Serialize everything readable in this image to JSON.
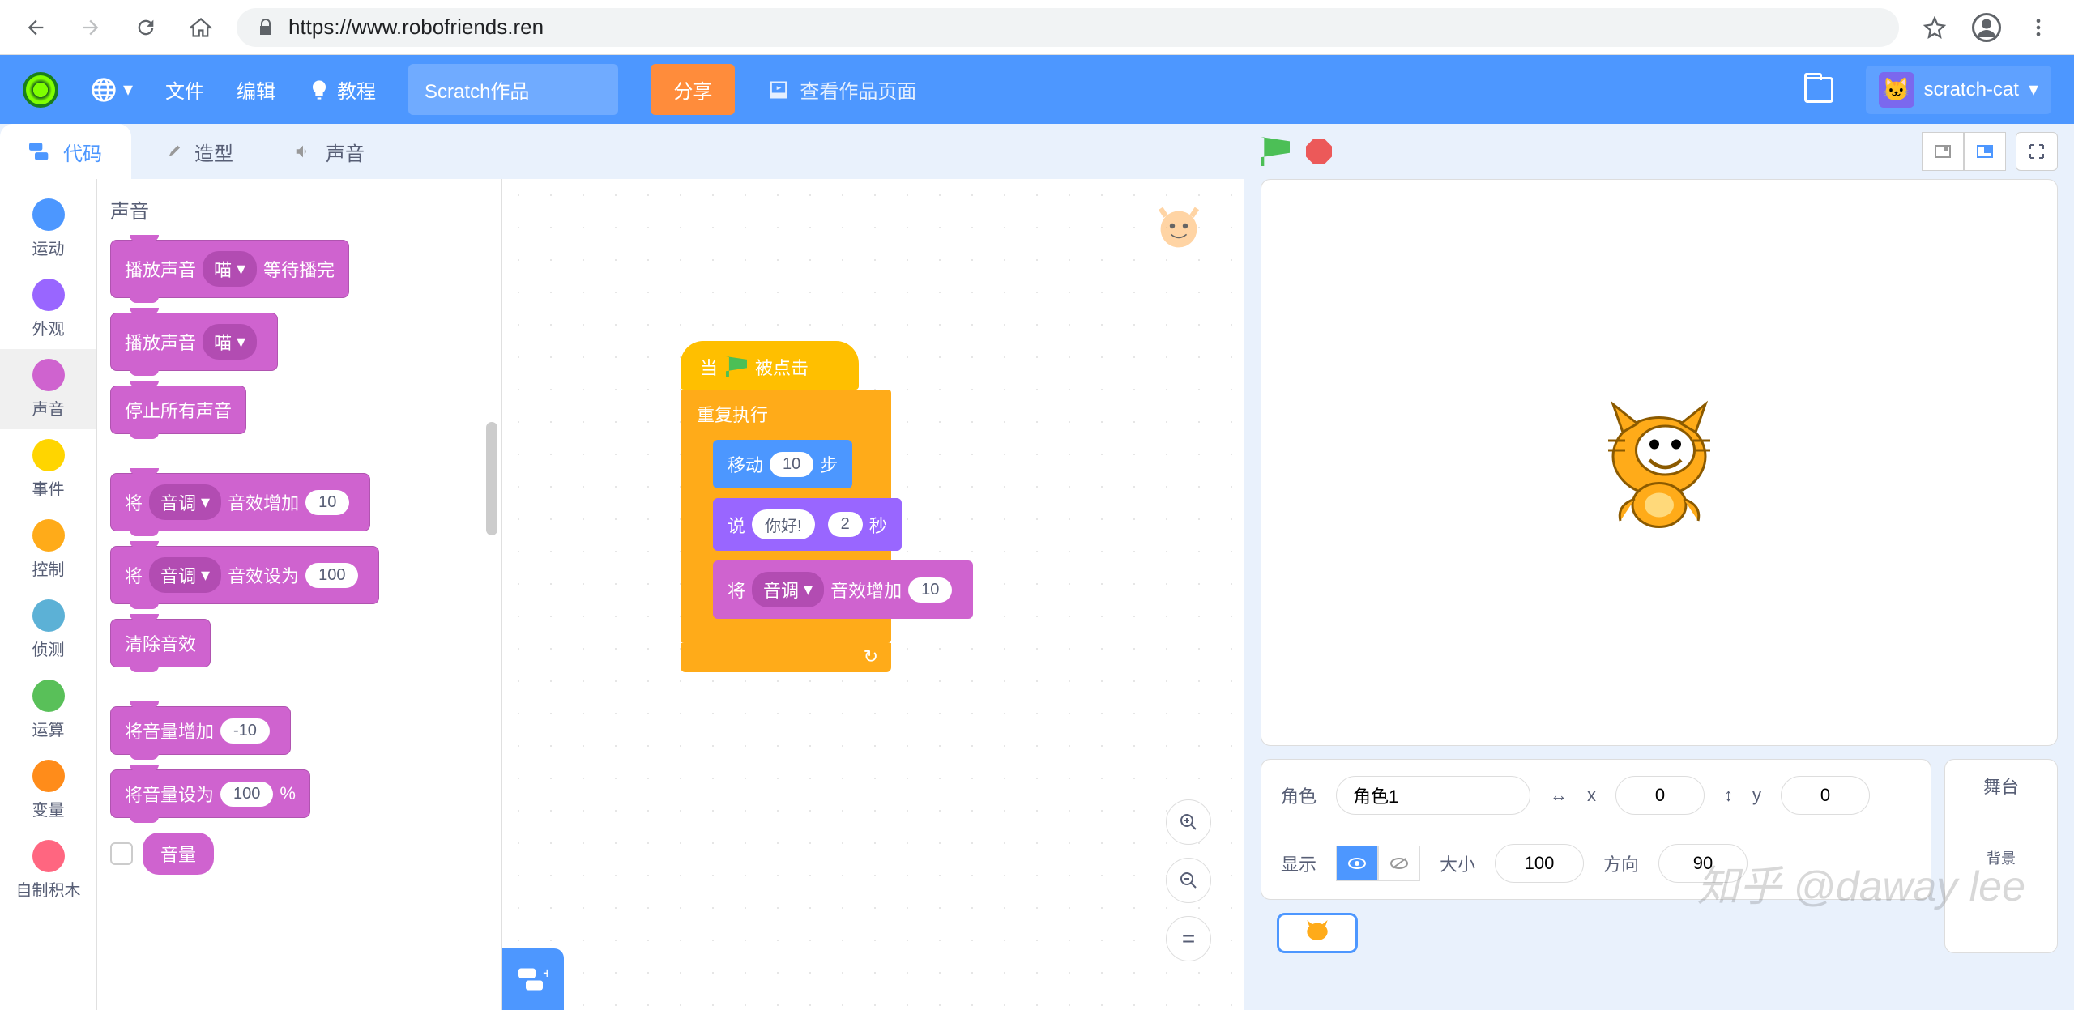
{
  "browser": {
    "url": "https://www.robofriends.ren"
  },
  "menu": {
    "file": "文件",
    "edit": "编辑",
    "tutorials": "教程",
    "project_title": "Scratch作品",
    "share": "分享",
    "view_page": "查看作品页面",
    "username": "scratch-cat"
  },
  "tabs": {
    "code": "代码",
    "costumes": "造型",
    "sounds": "声音"
  },
  "categories": [
    {
      "label": "运动",
      "color": "#4c97ff"
    },
    {
      "label": "外观",
      "color": "#9966ff"
    },
    {
      "label": "声音",
      "color": "#cf63cf"
    },
    {
      "label": "事件",
      "color": "#ffd500"
    },
    {
      "label": "控制",
      "color": "#ffab19"
    },
    {
      "label": "侦测",
      "color": "#5cb1d6"
    },
    {
      "label": "运算",
      "color": "#59c059"
    },
    {
      "label": "变量",
      "color": "#ff8c1a"
    },
    {
      "label": "自制积木",
      "color": "#ff6680"
    }
  ],
  "palette": {
    "title": "声音",
    "meow": "喵",
    "play_until_done_pre": "播放声音",
    "play_until_done_post": "等待播完",
    "play_sound": "播放声音",
    "stop_all": "停止所有声音",
    "change_effect_pre": "将",
    "pitch": "音调",
    "change_effect_post": "音效增加",
    "change_effect_val": "10",
    "set_effect_post": "音效设为",
    "set_effect_val": "100",
    "clear_effects": "清除音效",
    "change_volume": "将音量增加",
    "change_volume_val": "-10",
    "set_volume": "将音量设为",
    "set_volume_val": "100",
    "percent": "%",
    "volume": "音量"
  },
  "script": {
    "when_flag": "当",
    "clicked": "被点击",
    "forever": "重复执行",
    "move_pre": "移动",
    "move_val": "10",
    "move_post": "步",
    "say_pre": "说",
    "say_text": "你好!",
    "say_time": "2",
    "say_post": "秒",
    "effect_pre": "将",
    "effect_pitch": "音调",
    "effect_post": "音效增加",
    "effect_val": "10"
  },
  "sprite_info": {
    "sprite_label": "角色",
    "name": "角色1",
    "x_label": "x",
    "x": "0",
    "y_label": "y",
    "y": "0",
    "show_label": "显示",
    "size_label": "大小",
    "size": "100",
    "direction_label": "方向",
    "direction": "90"
  },
  "stage_panel": {
    "title": "舞台",
    "backdrop": "背景"
  },
  "watermark": "知乎 @daway lee"
}
